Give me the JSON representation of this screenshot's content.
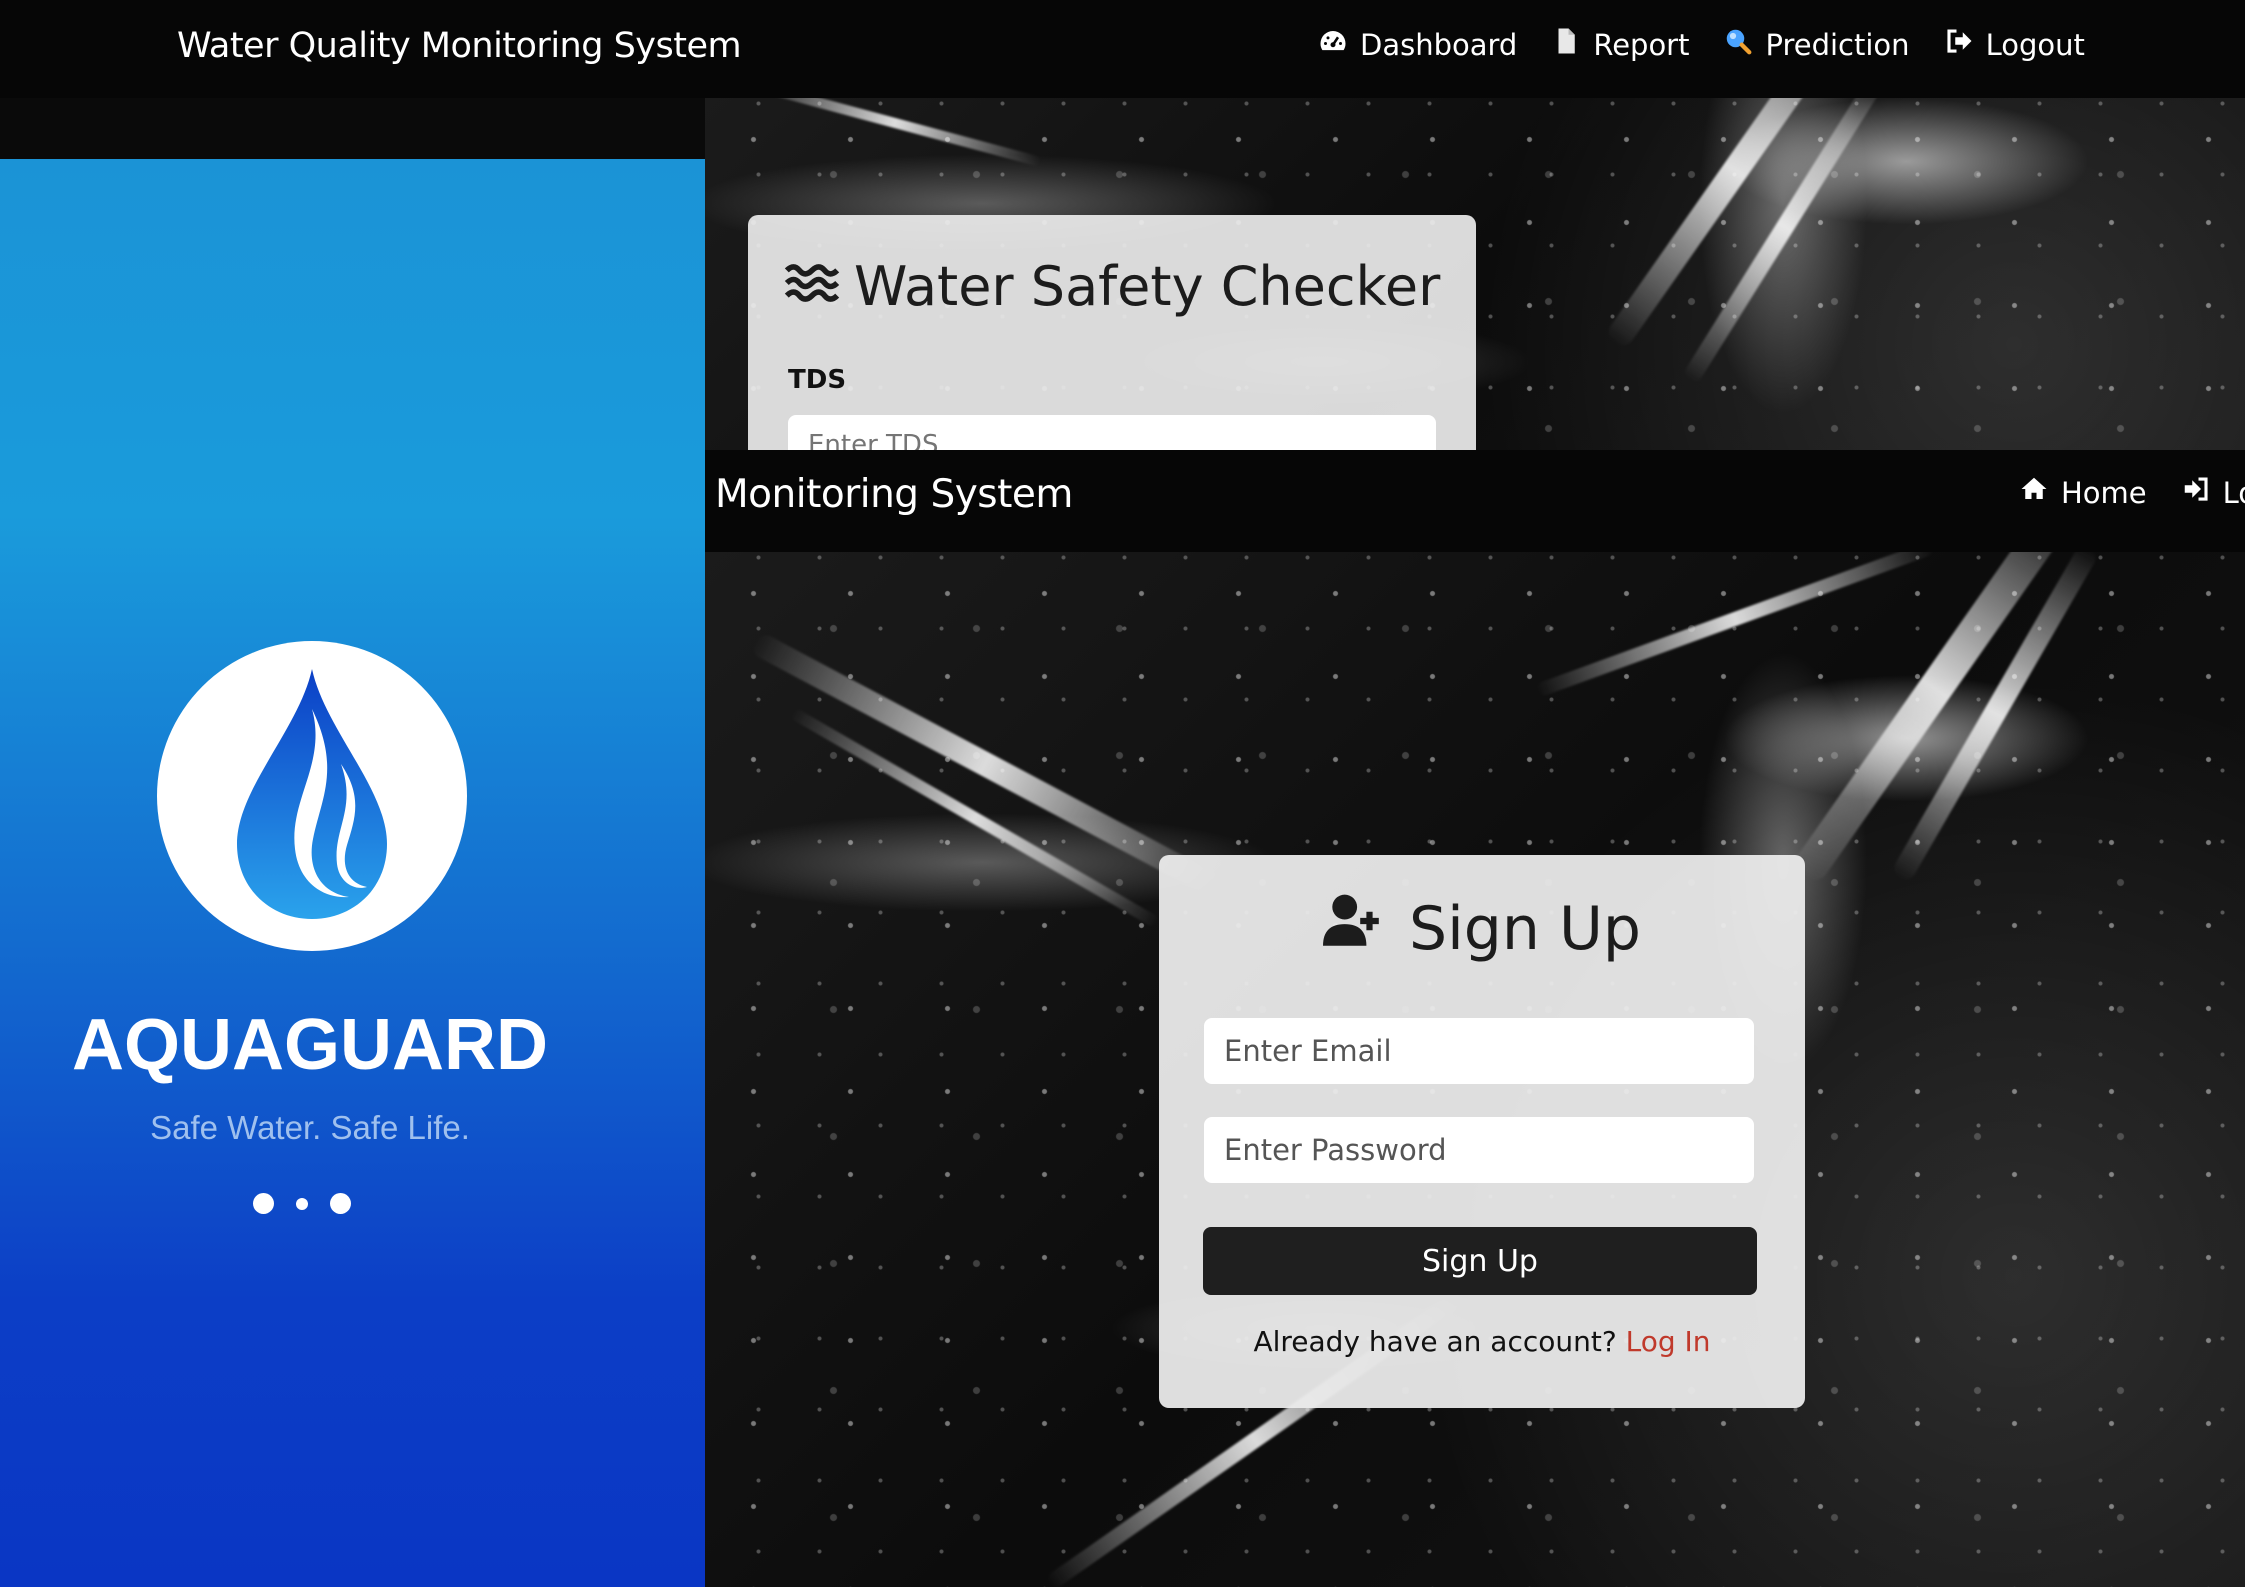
{
  "top_page": {
    "brand": "Water Quality Monitoring System",
    "nav": [
      {
        "label": "Dashboard",
        "icon": "speedometer-icon"
      },
      {
        "label": "Report",
        "icon": "document-icon"
      },
      {
        "label": "Prediction",
        "icon": "magnifier-icon"
      },
      {
        "label": "Logout",
        "icon": "logout-icon"
      }
    ],
    "card": {
      "title": "Water Safety Checker",
      "title_icon": "water-waves-icon",
      "field_label": "TDS",
      "field_placeholder": "Enter TDS"
    }
  },
  "bottom_page": {
    "brand": "Monitoring System",
    "nav": [
      {
        "label": "Home",
        "icon": "home-icon"
      },
      {
        "label": "Lo",
        "icon": "login-icon"
      }
    ],
    "card": {
      "title": "Sign Up",
      "title_icon": "user-plus-icon",
      "email_placeholder": "Enter Email",
      "password_placeholder": "Enter Password",
      "submit_label": "Sign Up",
      "footer_text": "Already have an account?",
      "footer_link": "Log In"
    }
  },
  "splash": {
    "app_name": "AQUAGUARD",
    "tagline": "Safe Water. Safe Life.",
    "logo_icon": "water-drop-icon",
    "colors": {
      "gradient_top": "#1b93d6",
      "gradient_bottom": "#0a36c4",
      "tagline": "#9fc0ee"
    }
  },
  "colors": {
    "nav_bg": "#060606",
    "card_bg": "#ececec",
    "button_bg": "#1f1f1f",
    "link": "#c0392b"
  }
}
